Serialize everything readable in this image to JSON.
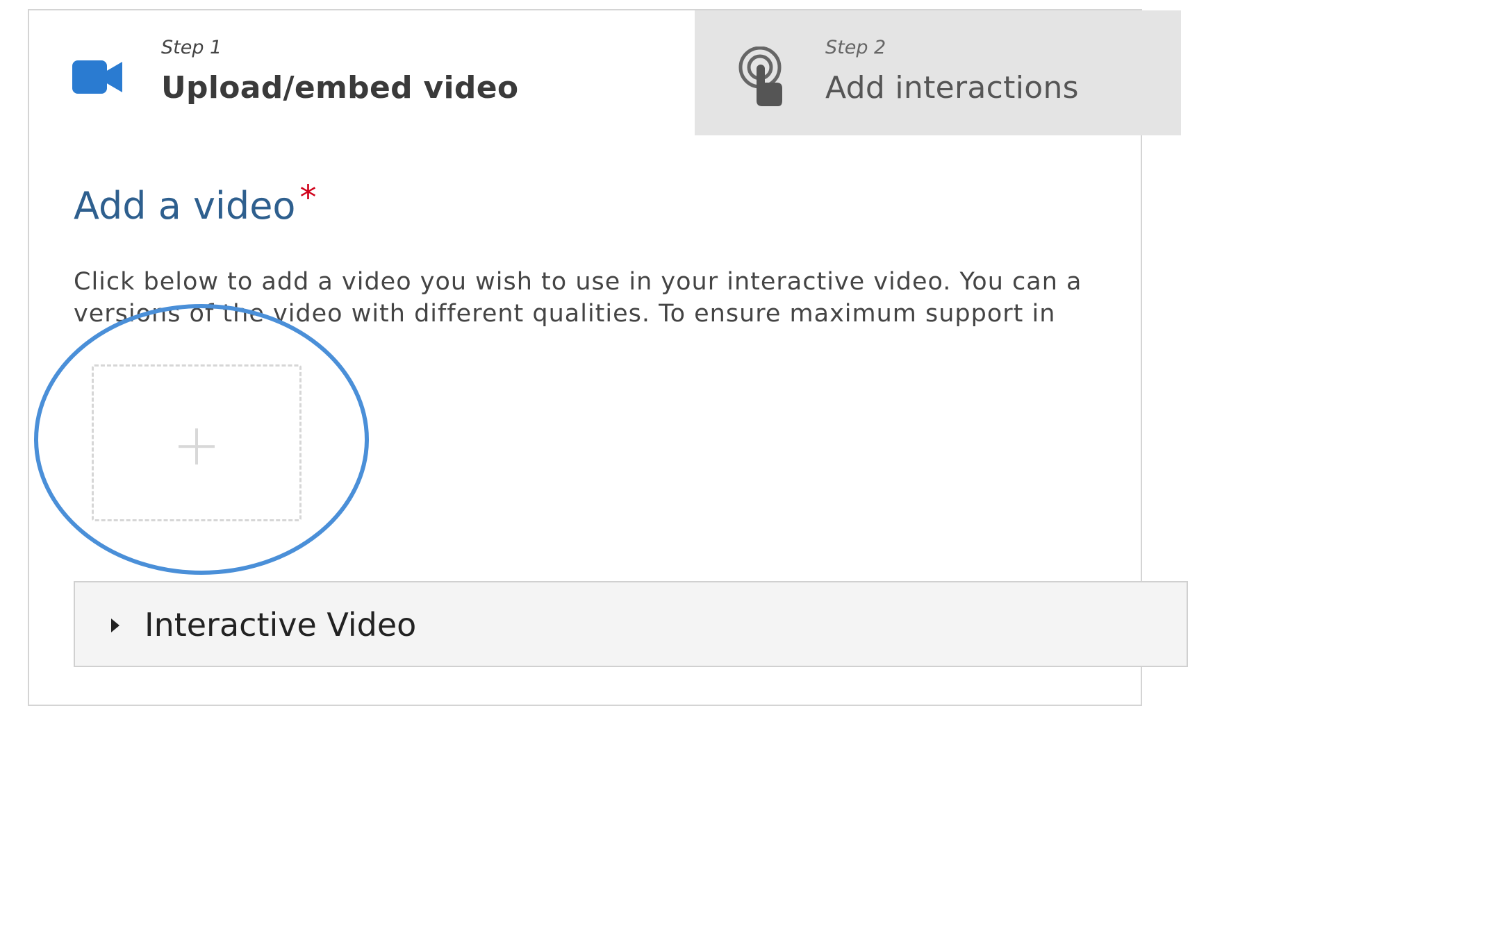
{
  "steps": [
    {
      "number": "Step 1",
      "title": "Upload/embed video",
      "icon": "video-camera-icon",
      "active": true
    },
    {
      "number": "Step 2",
      "title": "Add interactions",
      "icon": "touch-hand-icon",
      "active": false
    }
  ],
  "field": {
    "title": "Add a video",
    "required_mark": "*",
    "description_line1": "Click below to add a video you wish to use in your interactive video. You can a",
    "description_line2": "versions of the video with different qualities. To ensure maximum support in"
  },
  "add_button": {
    "icon": "plus-icon"
  },
  "group": {
    "title": "Interactive Video",
    "icon": "caret-right-icon"
  },
  "colors": {
    "accent_blue": "#2a7bd1",
    "title_blue": "#2e5f8e",
    "required_red": "#d0021b",
    "highlight_circle": "#4a8fd8",
    "inactive_tab_bg": "#e4e4e4"
  }
}
